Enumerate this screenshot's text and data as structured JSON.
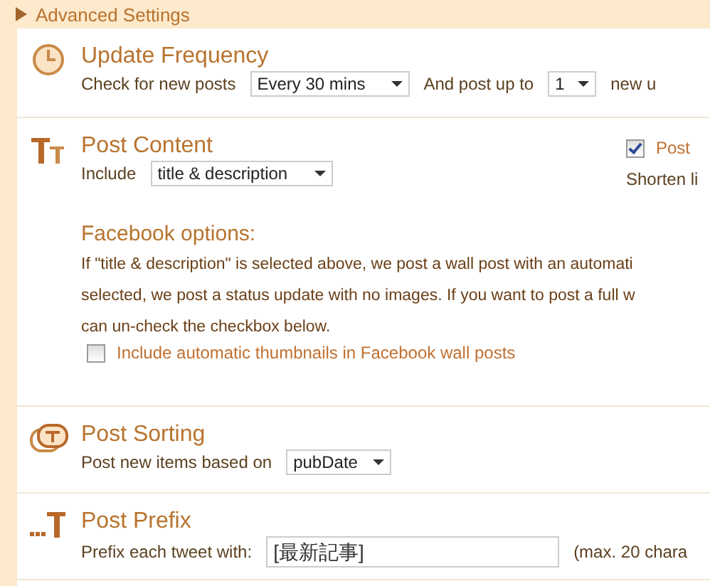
{
  "header": {
    "label": "Advanced Settings",
    "expanded": false
  },
  "sections": [
    {
      "kind": "frequency",
      "title": "Update Frequency",
      "label": "Check for new posts",
      "interval": "Every 30 mins",
      "label_2": "And post up to",
      "count": "1",
      "label_3": "new u"
    },
    {
      "kind": "content",
      "title": "Post Content",
      "label": "Include",
      "include": "title & description",
      "side_checkbox": {
        "label": "Post",
        "checked": true
      },
      "side_text": "Shorten li",
      "facebook": {
        "title": "Facebook options:",
        "lines": [
          "If \"title & description\" is selected above, we post a wall post with an automati",
          "selected, we post a status update with no images. If you want to post a full w",
          "can un-check the checkbox below."
        ],
        "checkbox": {
          "label": "Include automatic thumbnails in Facebook wall posts",
          "checked": false
        }
      }
    },
    {
      "kind": "sorting",
      "title": "Post Sorting",
      "label": "Post new items based on",
      "sort": "pubDate"
    },
    {
      "kind": "prefix",
      "title": "Post Prefix",
      "label": "Prefix each tweet with:",
      "value": "[最新記事]",
      "hint": "(max. 20 chara"
    }
  ]
}
